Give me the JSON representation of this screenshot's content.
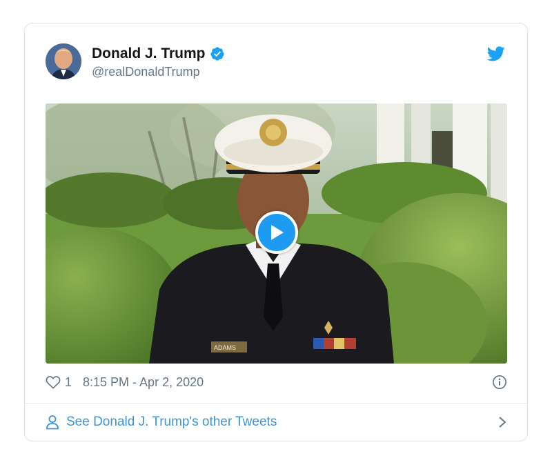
{
  "tweet": {
    "author_name": "Donald J. Trump",
    "author_handle": "@realDonaldTrump",
    "verified": true,
    "like_count": "1",
    "timestamp": "8:15 PM - Apr 2, 2020",
    "media": {
      "type": "video",
      "play_icon": "play-icon",
      "nameplate_text": "ADAMS"
    }
  },
  "footer": {
    "see_more_label": "See Donald J. Trump's other Tweets",
    "person_icon": "person-icon",
    "chevron_icon": "chevron-right-icon"
  },
  "icons": {
    "twitter": "twitter-bird-icon",
    "verified": "verified-badge-icon",
    "like": "heart-icon",
    "info": "info-icon"
  },
  "colors": {
    "twitter_blue": "#1da1f2",
    "link_blue": "#3b94d9",
    "muted_text": "#657786",
    "border": "#dfe4e8"
  }
}
